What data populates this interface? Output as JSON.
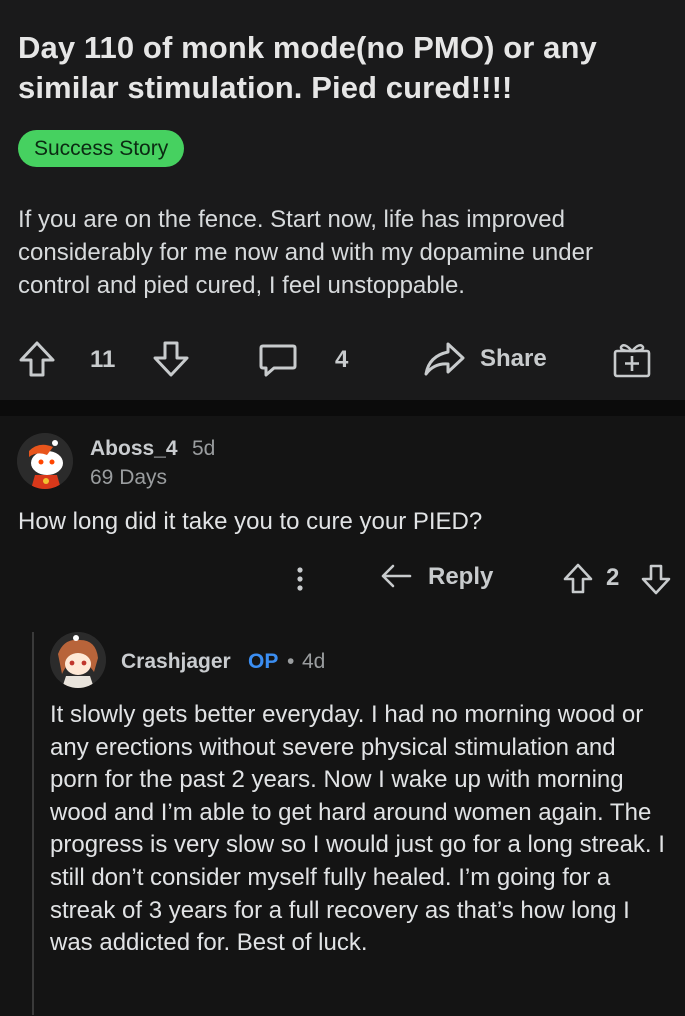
{
  "post": {
    "title": "Day 110 of monk mode(no PMO) or any similar stimulation. Pied cured!!!!",
    "flair": "Success Story",
    "body": "If you are on the fence. Start now, life has improved considerably for me now and with my dopamine under control and pied cured, I feel unstoppable.",
    "votes": "11",
    "comments": "4",
    "share_label": "Share",
    "icons": [
      "upvote-icon",
      "downvote-icon",
      "comment-icon",
      "share-icon",
      "award-icon"
    ]
  },
  "comments": [
    {
      "username": "Aboss_4",
      "age": "5d",
      "flair": "69 Days",
      "text": "How long did it take you to cure your PIED?",
      "reply_label": "Reply",
      "votes": "2"
    },
    {
      "username": "Crashjager",
      "op_badge": "OP",
      "separator": "•",
      "age": "4d",
      "text": "It slowly gets better everyday. I had no morning wood or any erections without severe physical stimulation and porn for the past 2 years. Now I wake up with morning wood and I’m able to get hard around women again. The progress is very slow so I would just go for a long streak. I still don’t consider myself fully healed. I’m going for a streak of 3 years for a full recovery as that’s how long I was addicted for. Best of luck."
    }
  ],
  "colors": {
    "flair_bg": "#46d160",
    "op": "#3b8ef2",
    "background": "#101010"
  }
}
